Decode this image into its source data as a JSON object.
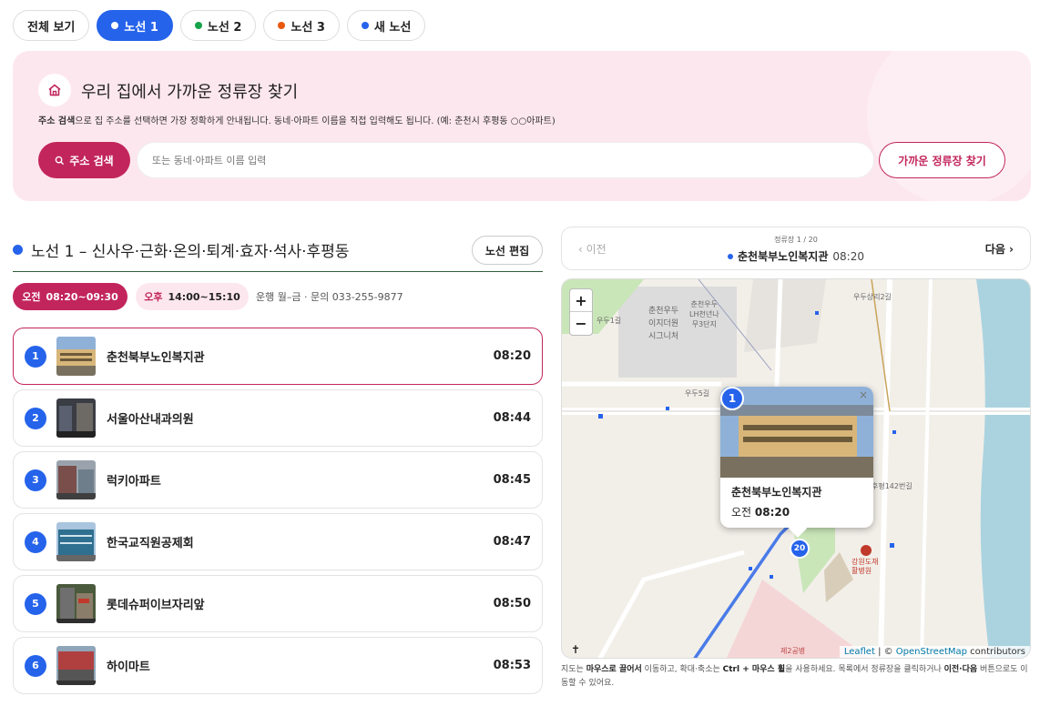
{
  "tabs": [
    {
      "label": "전체 보기",
      "color": ""
    },
    {
      "label": "노선 1",
      "color": "#ffffff"
    },
    {
      "label": "노선 2",
      "color": "#16a34a"
    },
    {
      "label": "노선 3",
      "color": "#ea580c"
    },
    {
      "label": "새 노선",
      "color": "#2563eb"
    }
  ],
  "hero": {
    "title": "우리 집에서 가까운 정류장 찾기",
    "desc_bold": "주소 검색",
    "desc_rest": "으로 집 주소를 선택하면 가장 정확하게 안내됩니다. 동네·아파트 이름을 직접 입력해도 됩니다. (예: 춘천시 후평동 ○○아파트)",
    "addr_button": "주소 검색",
    "input_placeholder": "또는 동네·아파트 이름 입력",
    "find_button": "가까운 정류장 찾기"
  },
  "route": {
    "title": "노선 1 – 신사우·근화·온의·퇴계·효자·석사·후평동",
    "edit_button": "노선 편집",
    "am_label": "오전",
    "am_time": "08:20~09:30",
    "pm_label": "오후",
    "pm_time": "14:00~15:10",
    "ops": "운행 월–금 · 문의 033-255-9877"
  },
  "stops": [
    {
      "num": "1",
      "name": "춘천북부노인복지관",
      "time": "08:20"
    },
    {
      "num": "2",
      "name": "서울아산내과의원",
      "time": "08:44"
    },
    {
      "num": "3",
      "name": "럭키아파트",
      "time": "08:45"
    },
    {
      "num": "4",
      "name": "한국교직원공제회",
      "time": "08:47"
    },
    {
      "num": "5",
      "name": "롯데슈퍼이브자리앞",
      "time": "08:50"
    },
    {
      "num": "6",
      "name": "하이마트",
      "time": "08:53"
    }
  ],
  "navigator": {
    "prev": "이전",
    "counter": "정류장 1 / 20",
    "current_name": "춘천북부노인복지관",
    "current_time": "08:20",
    "next": "다음"
  },
  "map": {
    "zoom_in": "+",
    "zoom_out": "−",
    "popup_name": "춘천북부노인복지관",
    "popup_label": "오전",
    "popup_time": "08:20",
    "marker_first": "1",
    "marker_last": "20",
    "attribution_leaflet": "Leaflet",
    "attribution_sep": " | © ",
    "attribution_osm": "OpenStreetMap",
    "attribution_rest": " contributors",
    "labels": {
      "apt": "춘천우두\n이지더원\n시그니처",
      "lh": "춘천우두\nLH천년나\n무3단지",
      "road1": "우두5길",
      "road2": "우두상리2길",
      "road3": "우두1길",
      "road4": "후평142번길",
      "hospital": "강원도재\n활병원",
      "park": "제2공병"
    }
  },
  "hint": {
    "p1": "지도는 ",
    "b1": "마우스로 끌어서",
    "p2": " 이동하고, 확대·축소는 ",
    "b2": "Ctrl + 마우스 휠",
    "p3": "을 사용하세요. 목록에서 정류장을 클릭하거나 ",
    "b3": "이전·다음",
    "p4": " 버튼으로도 이동할 수 있어요."
  }
}
